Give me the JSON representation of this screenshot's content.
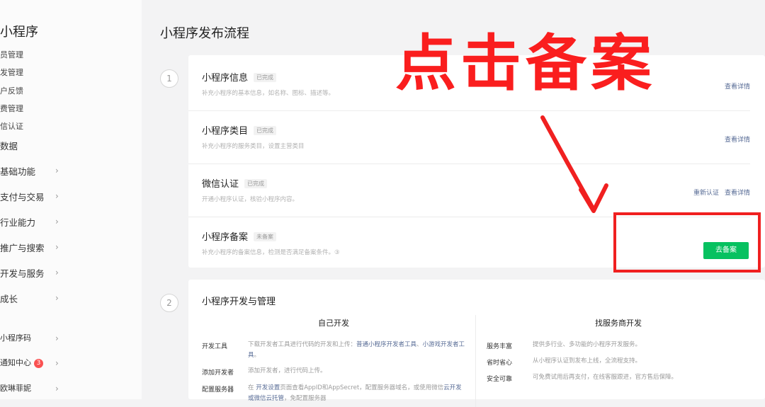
{
  "sidebar": {
    "title": "小程序",
    "sub_items": [
      "员管理",
      "发管理",
      "户反馈",
      "费管理",
      "信认证",
      "数据"
    ],
    "menu_items": [
      {
        "label": "基础功能"
      },
      {
        "label": "支付与交易"
      },
      {
        "label": "行业能力"
      },
      {
        "label": "推广与搜索"
      },
      {
        "label": "开发与服务"
      },
      {
        "label": "成长"
      }
    ],
    "bottom_items": [
      {
        "label": "小程序码"
      },
      {
        "label": "通知中心",
        "badge": "3"
      },
      {
        "label": "欧琳菲妮"
      }
    ]
  },
  "main": {
    "title": "小程序发布流程",
    "step1": {
      "number": "1",
      "rows": [
        {
          "title": "小程序信息",
          "tag": "已完成",
          "desc": "补充小程序的基本信息，如名称、图标、描述等。",
          "links": [
            "查看详情"
          ]
        },
        {
          "title": "小程序类目",
          "tag": "已完成",
          "desc": "补充小程序的服务类目，设置主营类目",
          "links": [
            "查看详情"
          ]
        },
        {
          "title": "微信认证",
          "tag": "已完成",
          "desc": "开通小程序认证，核验小程序内容。",
          "links": [
            "重新认证",
            "查看详情"
          ]
        },
        {
          "title": "小程序备案",
          "tag": "未备案",
          "desc": "补充小程序的备案信息，检测是否满足备案条件。③",
          "button": "去备案"
        }
      ]
    },
    "step2": {
      "number": "2",
      "title": "小程序开发与管理",
      "self_dev": {
        "heading": "自己开发",
        "items": [
          {
            "key": "开发工具",
            "value_pre": "下载开发者工具进行代码的开发和上传：",
            "link1": "普通小程序开发者工具",
            "sep": "、",
            "link2": "小游戏开发者工具",
            "value_post": "。"
          },
          {
            "key": "添加开发者",
            "value": "添加开发者，进行代码上传。"
          },
          {
            "key": "配置服务器",
            "value_pre": "在 ",
            "link1": "开发设置",
            "value_mid": "页面查看AppID和AppSecret，配置服务器域名，或使用微信",
            "link2": "云开发或微信云托管",
            "value_post": "，免配置服务器"
          }
        ]
      },
      "vendor_dev": {
        "heading": "找服务商开发",
        "items": [
          {
            "key": "服务丰富",
            "value": "提供多行业、多功能的小程序开发服务。"
          },
          {
            "key": "省时省心",
            "value": "从小程序认证到发布上线，全流程支持。"
          },
          {
            "key": "安全可靠",
            "value": "可免费试用后再支付，在线客服跟进，官方售后保障。"
          }
        ]
      }
    }
  },
  "annotation": {
    "text": "点击备案",
    "color": "#fa1e1e"
  },
  "colors": {
    "accent_green": "#07c160",
    "link_blue": "#576b95",
    "badge_red": "#fa5151"
  }
}
